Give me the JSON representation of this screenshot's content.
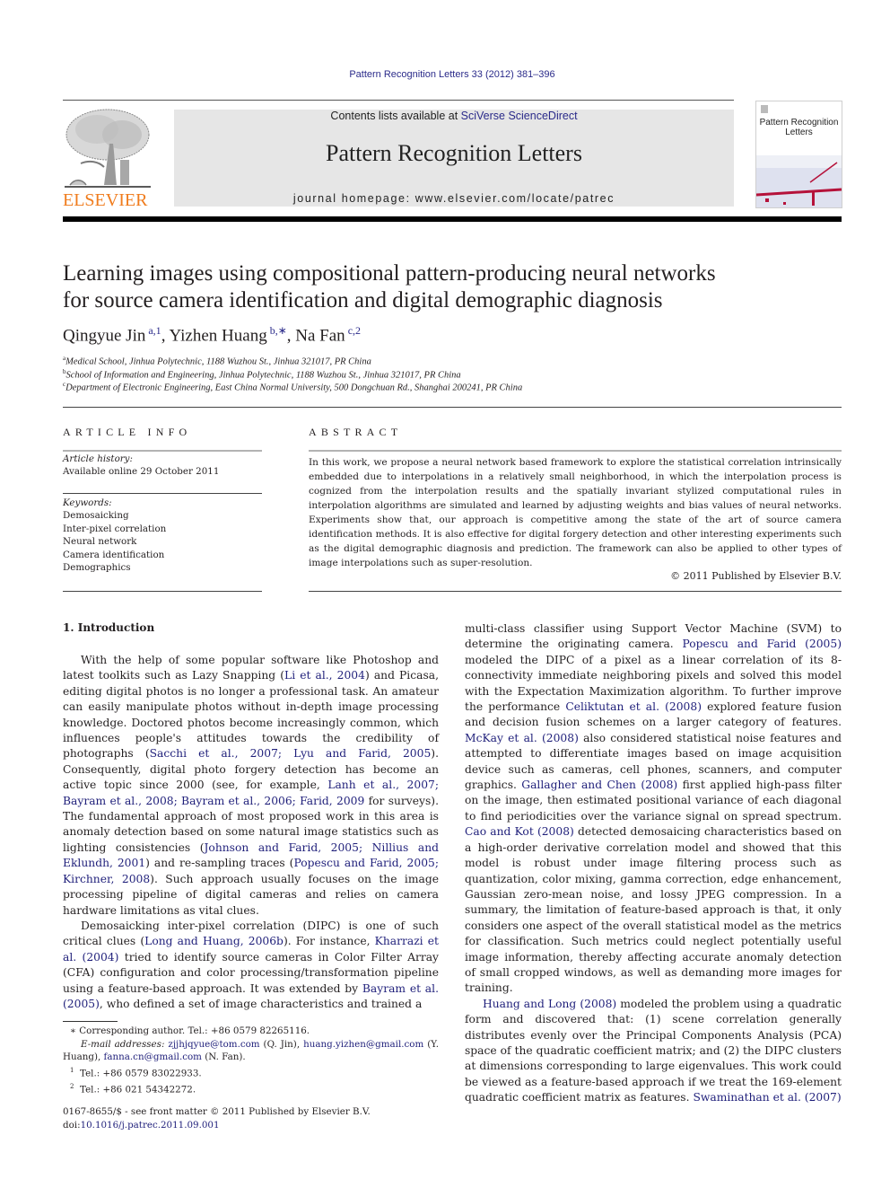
{
  "header": {
    "journal_reference": "Pattern Recognition Letters 33 (2012) 381–396",
    "publisher_logo_text": "ELSEVIER",
    "contents_prefix": "Contents lists available at ",
    "contents_link": "SciVerse ScienceDirect",
    "journal_title": "Pattern Recognition Letters",
    "homepage_label": "journal homepage: www.elsevier.com/locate/patrec",
    "cover_title_line1": "Pattern Recognition",
    "cover_title_line2": "Letters"
  },
  "colors": {
    "link": "#1f1f7a",
    "elsevier_orange": "#f07c1d",
    "banner_grey": "#e6e6e6",
    "cover_red": "#b5123a"
  },
  "article": {
    "title_line1": "Learning images using compositional pattern-producing neural networks",
    "title_line2": "for source camera identification and digital demographic diagnosis",
    "authors": [
      {
        "name": "Qingyue Jin",
        "marks": "a,1",
        "sep": ", "
      },
      {
        "name": "Yizhen Huang",
        "marks": "b,∗",
        "sep": ", "
      },
      {
        "name": "Na Fan",
        "marks": "c,2",
        "sep": ""
      }
    ],
    "affiliations": [
      {
        "mark": "a",
        "text": "Medical School, Jinhua Polytechnic, 1188 Wuzhou St., Jinhua 321017, PR China"
      },
      {
        "mark": "b",
        "text": "School of Information and Engineering, Jinhua Polytechnic, 1188 Wuzhou St., Jinhua 321017, PR China"
      },
      {
        "mark": "c",
        "text": "Department of Electronic Engineering, East China Normal University, 500 Dongchuan Rd., Shanghai 200241, PR China"
      }
    ]
  },
  "article_info": {
    "heading": "ARTICLE INFO",
    "history_label": "Article history:",
    "history_value": "Available online 29 October 2011",
    "keywords_label": "Keywords:",
    "keywords": [
      "Demosaicking",
      "Inter-pixel correlation",
      "Neural network",
      "Camera identification",
      "Demographics"
    ]
  },
  "abstract": {
    "heading": "ABSTRACT",
    "text": "In this work, we propose a neural network based framework to explore the statistical correlation intrinsically embedded due to interpolations in a relatively small neighborhood, in which the interpolation process is cognized from the interpolation results and the spatially invariant stylized computational rules in interpolation algorithms are simulated and learned by adjusting weights and bias values of neural networks. Experiments show that, our approach is competitive among the state of the art of source camera identification methods. It is also effective for digital forgery detection and other interesting experiments such as the digital demographic diagnosis and prediction. The framework can also be applied to other types of image interpolations such as super-resolution.",
    "copyright": "© 2011 Published by Elsevier B.V."
  },
  "introduction": {
    "heading": "1. Introduction",
    "p1": [
      {
        "t": "With the help of some popular software like Photoshop and latest toolkits such as Lazy Snapping ("
      },
      {
        "t": "Li et al., 2004",
        "link": true
      },
      {
        "t": ") and Picasa, editing digital photos is no longer a professional task. An amateur can easily manipulate photos without in-depth image processing knowledge. Doctored photos become increasingly common, which influences people's attitudes towards the credibility of photographs ("
      },
      {
        "t": "Sacchi et al., 2007; Lyu and Farid, 2005",
        "link": true
      },
      {
        "t": "). Consequently, digital photo forgery detection has become an active topic since 2000 (see, for example, "
      },
      {
        "t": "Lanh et al., 2007; Bayram et al., 2008; Bayram et al., 2006; Farid, 2009",
        "link": true
      },
      {
        "t": " for surveys). The fundamental approach of most proposed work in this area is anomaly detection based on some natural image statistics such as lighting consistencies ("
      },
      {
        "t": "Johnson and Farid, 2005; Nillius and Eklundh, 2001",
        "link": true
      },
      {
        "t": ") and re-sampling traces ("
      },
      {
        "t": "Popescu and Farid, 2005; Kirchner, 2008",
        "link": true
      },
      {
        "t": "). Such approach usually focuses on the image processing pipeline of digital cameras and relies on camera hardware limitations as vital clues."
      }
    ],
    "p2": [
      {
        "t": "Demosaicking inter-pixel correlation (DIPC) is one of such critical clues ("
      },
      {
        "t": "Long and Huang, 2006b",
        "link": true
      },
      {
        "t": "). For instance, "
      },
      {
        "t": "Kharrazi et al. (2004)",
        "link": true
      },
      {
        "t": " tried to identify source cameras in Color Filter Array (CFA) configuration and color processing/transformation pipeline using a feature-based approach. It was extended by "
      },
      {
        "t": "Bayram et al. (2005)",
        "link": true
      },
      {
        "t": ", who defined a set of image characteristics and trained a"
      }
    ],
    "p3": [
      {
        "t": "multi-class classifier using Support Vector Machine (SVM) to determine the originating camera. "
      },
      {
        "t": "Popescu and Farid (2005)",
        "link": true
      },
      {
        "t": " modeled the DIPC of a pixel as a linear correlation of its 8-connectivity immediate neighboring pixels and solved this model with the Expectation Maximization algorithm. To further improve the performance "
      },
      {
        "t": "Celiktutan et al. (2008)",
        "link": true
      },
      {
        "t": " explored feature fusion and decision fusion schemes on a larger category of features. "
      },
      {
        "t": "McKay et al. (2008)",
        "link": true
      },
      {
        "t": " also considered statistical noise features and attempted to differentiate images based on image acquisition device such as cameras, cell phones, scanners, and computer graphics. "
      },
      {
        "t": "Gallagher and Chen (2008)",
        "link": true
      },
      {
        "t": " first applied high-pass filter on the image, then estimated positional variance of each diagonal to find periodicities over the variance signal on spread spectrum. "
      },
      {
        "t": "Cao and Kot (2008)",
        "link": true
      },
      {
        "t": " detected demosaicing characteristics based on a high-order derivative correlation model and showed that this model is robust under image filtering process such as quantization, color mixing, gamma correction, edge enhancement, Gaussian zero-mean noise, and lossy JPEG compression. In a summary, the limitation of feature-based approach is that, it only considers one aspect of the overall statistical model as the metrics for classification. Such metrics could neglect potentially useful image information, thereby affecting accurate anomaly detection of small cropped windows, as well as demanding more images for training."
      }
    ],
    "p4": [
      {
        "t": "Huang and Long (2008)",
        "link": true
      },
      {
        "t": " modeled the problem using a quadratic form and discovered that: (1) scene correlation generally distributes evenly over the Principal Components Analysis (PCA) space of the quadratic coefficient matrix; and (2) the DIPC clusters at dimensions corresponding to large eigenvalues. This work could be viewed as a feature-based approach if we treat the 169-element quadratic coefficient matrix as features. "
      },
      {
        "t": "Swaminathan et al. (2007)",
        "link": true
      }
    ]
  },
  "footnotes": {
    "corresponding": "∗  Corresponding author. Tel.: +86 0579 82265116.",
    "email_label": "E-mail addresses:",
    "emails": [
      {
        "addr": "zjjhjqyue@tom.com",
        "who": " (Q. Jin), "
      },
      {
        "addr": "huang.yizhen@gmail.com",
        "who": " (Y. Huang), "
      },
      {
        "addr": "fanna.cn@gmail.com",
        "who": " (N. Fan)."
      }
    ],
    "note1": "Tel.: +86 0579 83022933.",
    "note2": "Tel.: +86 021 54342272.",
    "frontmatter": "0167-8655/$ - see front matter © 2011 Published by Elsevier B.V.",
    "doi_prefix": "doi:",
    "doi": "10.1016/j.patrec.2011.09.001"
  }
}
